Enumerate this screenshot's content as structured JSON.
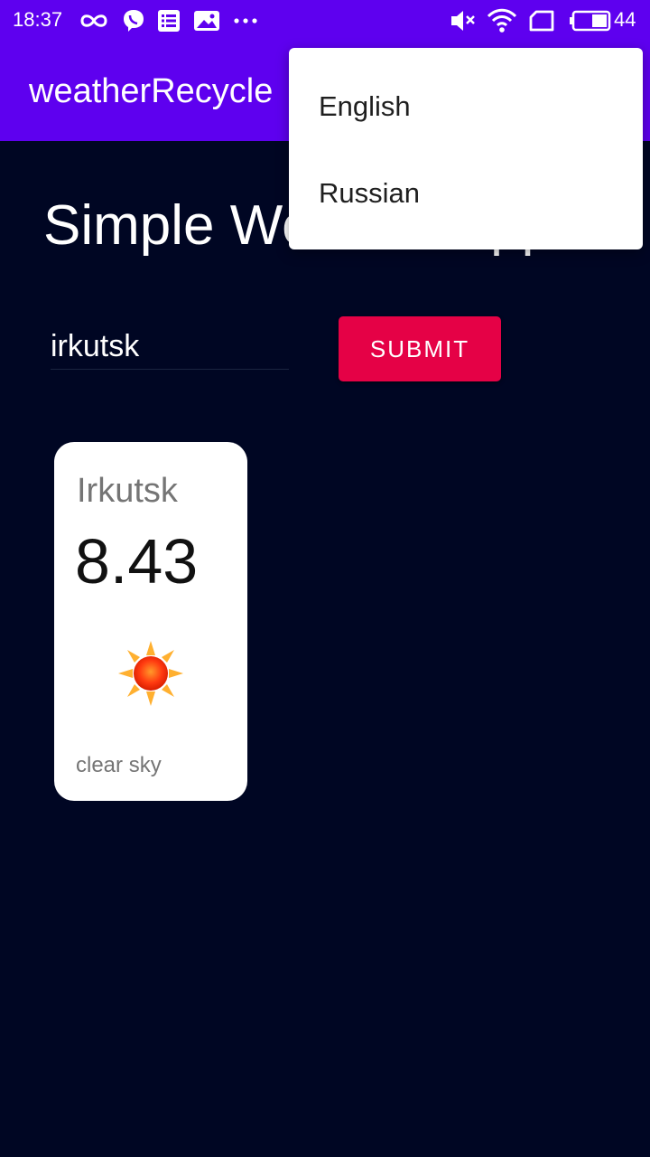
{
  "status_bar": {
    "time": "18:37",
    "battery_percent": "44",
    "icons": [
      "infinity-icon",
      "viber-icon",
      "notes-icon",
      "gallery-icon",
      "more-dots-icon",
      "mute-icon",
      "wifi-icon",
      "sim-icon",
      "battery-icon"
    ]
  },
  "app_bar": {
    "title": "weatherRecycle",
    "color": "#5e00ef"
  },
  "main": {
    "heading": "Simple Weather App",
    "city_input_value": "irkutsk",
    "submit_label": "SUBMIT",
    "submit_color": "#e50146",
    "background": "#000623"
  },
  "weather_card": {
    "city": "Irkutsk",
    "temperature": "8.43",
    "icon": "sun-icon",
    "description": "clear sky"
  },
  "language_menu": {
    "items": [
      "English",
      "Russian"
    ]
  }
}
